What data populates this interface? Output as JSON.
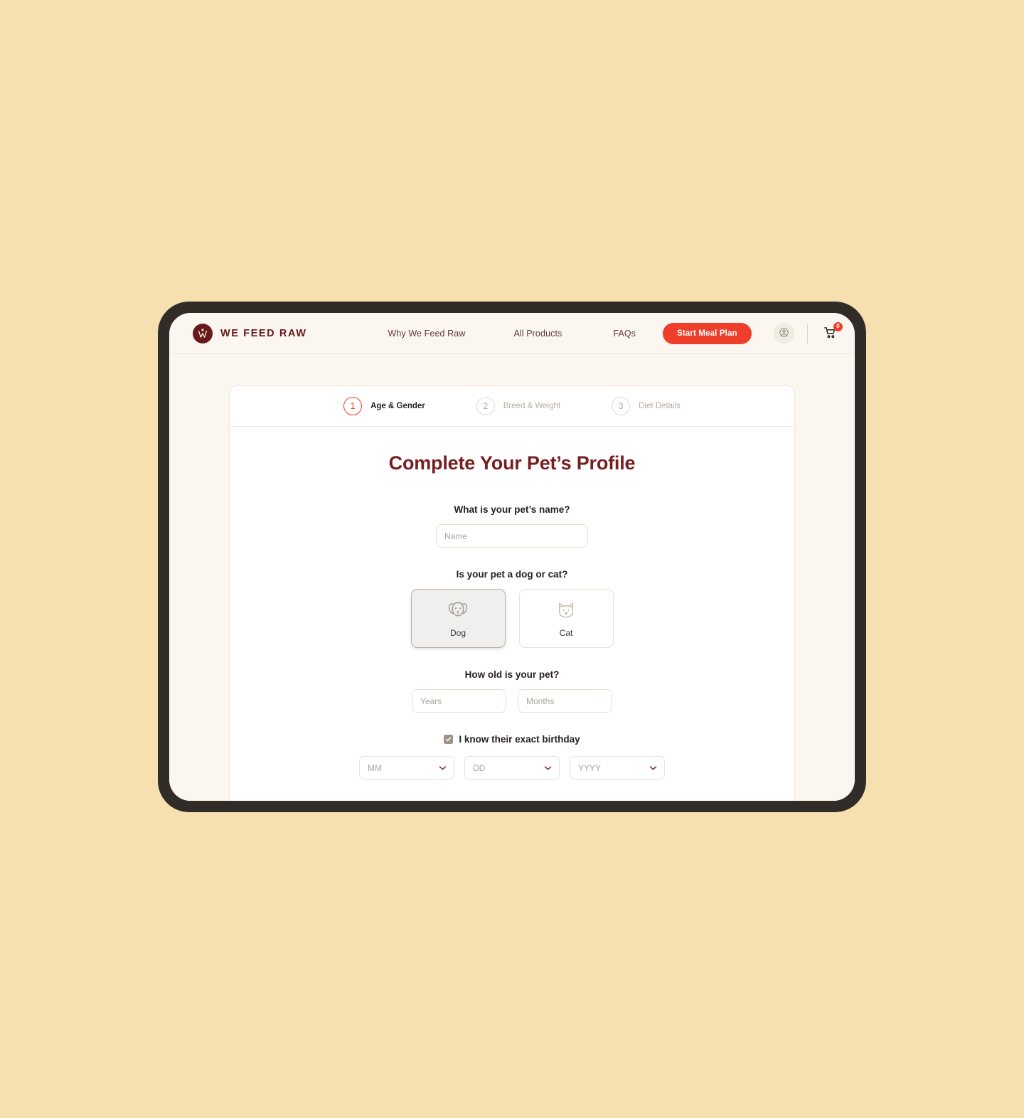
{
  "page": {
    "background_color": "#f6e0b0",
    "device_frame_color": "#322c29",
    "screen_background": "#fbf7f0"
  },
  "nav": {
    "brand_name": "WE FEED RAW",
    "brand_color": "#661a1c",
    "links": [
      {
        "label": "Why We Feed Raw",
        "name": "nav-link-why-we-feed-raw"
      },
      {
        "label": "All Products",
        "name": "nav-link-all-products"
      },
      {
        "label": "FAQs",
        "name": "nav-link-faqs"
      }
    ],
    "cta_label": "Start Meal Plan",
    "cta_color": "#ef3e2a",
    "cart_count": "0",
    "icons": {
      "brand": "w-monogram-icon",
      "account": "account-circle-icon",
      "cart": "shopping-cart-icon"
    }
  },
  "wizard": {
    "steps": [
      {
        "number": "1",
        "label": "Age & Gender",
        "active": true
      },
      {
        "number": "2",
        "label": "Breed & Weight",
        "active": false
      },
      {
        "number": "3",
        "label": "Diet Details",
        "active": false
      }
    ],
    "active_step_color": "#ef3e2a",
    "inactive_step_color": "#b5ada0"
  },
  "form": {
    "title": "Complete Your Pet’s Profile",
    "title_color": "#761f21",
    "name_question": "What is your pet’s name?",
    "name_placeholder": "Name",
    "name_value": "",
    "type_question": "Is your pet a dog or cat?",
    "pet_types": [
      {
        "label": "Dog",
        "icon": "dog-face-icon",
        "selected": true
      },
      {
        "label": "Cat",
        "icon": "cat-face-icon",
        "selected": false
      }
    ],
    "age_question": "How old is your pet?",
    "years_placeholder": "Years",
    "years_value": "",
    "months_placeholder": "Months",
    "months_value": "",
    "birthday_checkbox_label": "I know their exact birthday",
    "birthday_checked": true,
    "date_selects": [
      {
        "placeholder": "MM",
        "value": "",
        "name": "birth-month-select"
      },
      {
        "placeholder": "DD",
        "value": "",
        "name": "birth-day-select"
      },
      {
        "placeholder": "YYYY",
        "value": "",
        "name": "birth-year-select"
      }
    ]
  }
}
